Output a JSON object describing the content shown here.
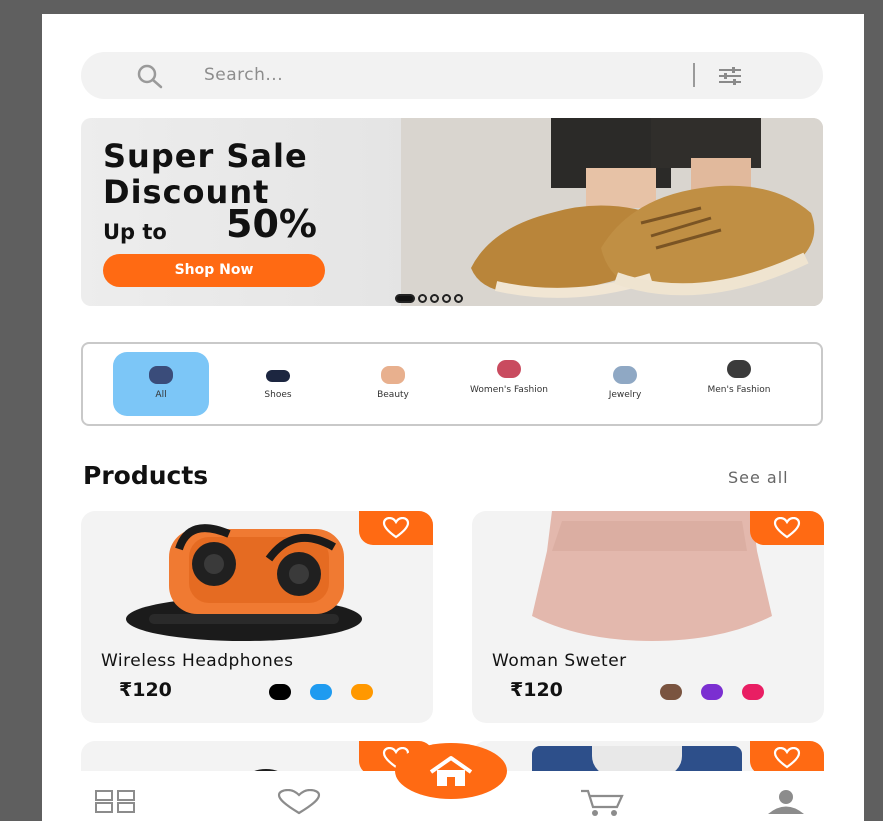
{
  "search": {
    "placeholder": "Search...",
    "icons": [
      "search-icon",
      "filter-icon"
    ]
  },
  "banner": {
    "title_line1": "Super Sale",
    "title_line2": "Discount",
    "up_to": "Up to",
    "percent": "50%",
    "cta": "Shop Now",
    "slide_count": 5,
    "active_slide": 1
  },
  "categories": [
    {
      "label": "All",
      "active": true
    },
    {
      "label": "Shoes",
      "active": false
    },
    {
      "label": "Beauty",
      "active": false
    },
    {
      "label": "Women's Fashion",
      "active": false
    },
    {
      "label": "Jewelry",
      "active": false
    },
    {
      "label": "Men's Fashion",
      "active": false
    }
  ],
  "products_section": {
    "title": "Products",
    "see_all": "See all"
  },
  "products": [
    {
      "name": "Wireless Headphones",
      "price": "₹120",
      "colors": [
        "#000000",
        "#1f9bf0",
        "#ff9800"
      ]
    },
    {
      "name": "Woman Sweter",
      "price": "₹120",
      "colors": [
        "#7a5440",
        "#7b2fd1",
        "#e91e63"
      ]
    }
  ],
  "accent_color": "#ff6a13",
  "bottom_nav": {
    "items": [
      "grid-icon",
      "heart-icon",
      "home-icon",
      "cart-icon",
      "profile-icon"
    ],
    "active": "home-icon"
  }
}
